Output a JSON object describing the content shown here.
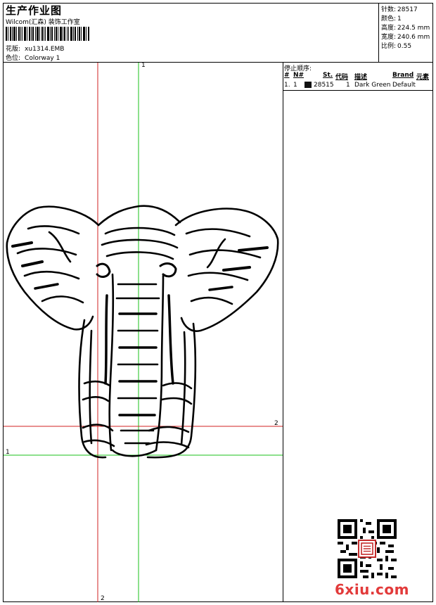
{
  "header": {
    "title": "生产作业图",
    "company": "Wilcom(汇森) 装饰工作室",
    "design_label": "花版:",
    "design_value": "xu1314.EMB",
    "colorway_label": "色位:",
    "colorway_value": "Colorway 1"
  },
  "stats": {
    "stitches_label": "针数:",
    "stitches_value": "28517",
    "colors_label": "颜色:",
    "colors_value": "1",
    "height_label": "高度:",
    "height_value": "224.5 mm",
    "width_label": "宽度:",
    "width_value": "240.6 mm",
    "scale_label": "比例:",
    "scale_value": "0.55"
  },
  "stop_sequence": {
    "title": "停止顺序:",
    "columns": [
      "#",
      "N#",
      "St.",
      "代码",
      "描述",
      "Brand",
      "元素"
    ],
    "rows": [
      {
        "index": "1.",
        "needle": "1",
        "stitches": "28515",
        "code": "1",
        "description": "Dark Green",
        "brand": "Default",
        "swatch_color": "#111111"
      }
    ]
  },
  "guides": {
    "v1_label": "1",
    "v1_bottom_label": "2",
    "h1_label": "1",
    "h2_label": "2"
  },
  "watermark": {
    "text": "6xiu.com"
  },
  "colors": {
    "guide_green": "#19c219",
    "guide_red": "#d02020",
    "watermark_red": "#e23a3a"
  }
}
